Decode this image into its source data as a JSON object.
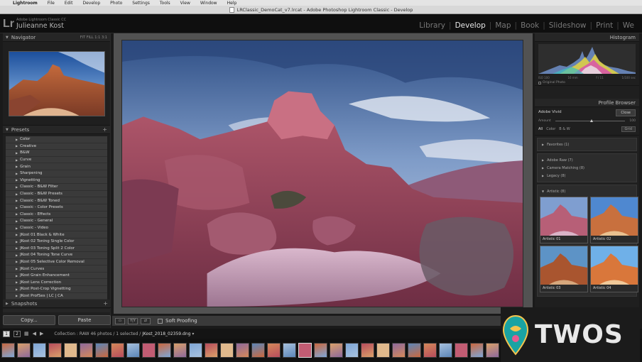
{
  "menubar": {
    "app": "Lightroom",
    "items": [
      "File",
      "Edit",
      "Develop",
      "Photo",
      "Settings",
      "Tools",
      "View",
      "Window",
      "Help"
    ]
  },
  "window": {
    "title": "LRClassic_DemoCat_v7.lrcat - Adobe Photoshop Lightroom Classic - Develop"
  },
  "identity": {
    "product": "Adobe Lightroom Classic CC",
    "user": "Julieanne Kost",
    "logo": "Lr"
  },
  "modules": [
    {
      "label": "Library",
      "active": false
    },
    {
      "label": "Develop",
      "active": true
    },
    {
      "label": "Map",
      "active": false
    },
    {
      "label": "Book",
      "active": false
    },
    {
      "label": "Slideshow",
      "active": false
    },
    {
      "label": "Print",
      "active": false
    },
    {
      "label": "We",
      "active": false
    }
  ],
  "left": {
    "navigator": {
      "title": "Navigator",
      "zoom": "FIT  FILL  1:1  3:1"
    },
    "presets": {
      "title": "Presets",
      "items": [
        "Color",
        "Creative",
        "B&W",
        "Curve",
        "Grain",
        "Sharpening",
        "Vignetting",
        "Classic - B&W Filter",
        "Classic - B&W Presets",
        "Classic - B&W Toned",
        "Classic - Color Presets",
        "Classic - Effects",
        "Classic - General",
        "Classic - Video",
        "JKost 01 Black & White",
        "JKost 02 Toning Single Color",
        "JKost 03 Toning Split 2 Color",
        "JKost 04 Toning Tone Curve",
        "JKost 05 Selective Color Removal",
        "JKost Curves",
        "JKost Grain Enhancement",
        "JKost Lens Correction",
        "JKost Post-Crop Vignetting",
        "JKost ProfSes | LC | CA"
      ]
    },
    "snapshots": {
      "title": "Snapshots"
    },
    "copy_label": "Copy...",
    "paste_label": "Paste"
  },
  "toolbar": {
    "soft_proofing": "Soft Proofing"
  },
  "right": {
    "histogram": {
      "title": "Histogram",
      "iso": "ISO 100",
      "focal": "16 mm",
      "aperture": "f / 11",
      "shutter": "1/100 sec",
      "original_photo": "Original Photo"
    },
    "profile_browser": {
      "title": "Profile Browser",
      "profile": "Adobe Vivid",
      "close": "Close",
      "amount": "Amount",
      "amount_value": 100,
      "filters": [
        "All",
        "Color",
        "B & W"
      ],
      "grid": "Grid",
      "groups": [
        {
          "label": "Favorites (1)"
        },
        {
          "label": "Adobe Raw (7)"
        },
        {
          "label": "Camera Matching (8)"
        },
        {
          "label": "Legacy (8)"
        },
        {
          "label": "Artistic (8)"
        }
      ],
      "tiles": [
        "Artistic 01",
        "Artistic 02",
        "Artistic 03",
        "Artistic 04"
      ]
    }
  },
  "filmstrip_bar": {
    "pages": [
      "1",
      "2"
    ],
    "collection_prefix": "Collection : RAW",
    "photos_text": "46 photos / 1 selected /",
    "filename": "JKost_2018_02359.dng"
  },
  "watermark": {
    "text": "TWOS"
  },
  "colors": {
    "accent_active": "#e6e6e6",
    "panel": "#1f1f1f",
    "preset_row": "#3a3a3a"
  }
}
